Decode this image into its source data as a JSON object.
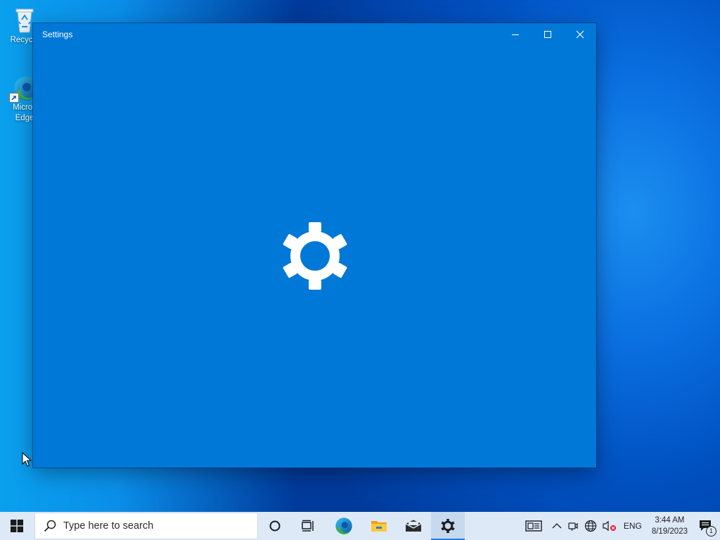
{
  "desktop": {
    "icons": [
      {
        "label": "Recycle Bin",
        "visible_label": "Recycle"
      },
      {
        "label_line1": "Micros",
        "label_line2": "Edge"
      }
    ]
  },
  "window": {
    "title": "Settings",
    "controls": {
      "minimize": "minimize",
      "maximize": "maximize",
      "close": "close"
    }
  },
  "taskbar": {
    "search_placeholder": "Type here to search",
    "pinned": [
      "cortana-icon",
      "task-view-icon",
      "edge-icon",
      "file-explorer-icon",
      "mail-icon",
      "settings-icon"
    ],
    "active_app": "settings-icon",
    "tray": {
      "language": "ENG",
      "time": "3:44 AM",
      "date": "8/19/2023",
      "notification_count": "1"
    }
  },
  "colors": {
    "window_bg": "#0078d7",
    "taskbar_bg": "#dde9f7",
    "accent": "#2a7ee0"
  }
}
